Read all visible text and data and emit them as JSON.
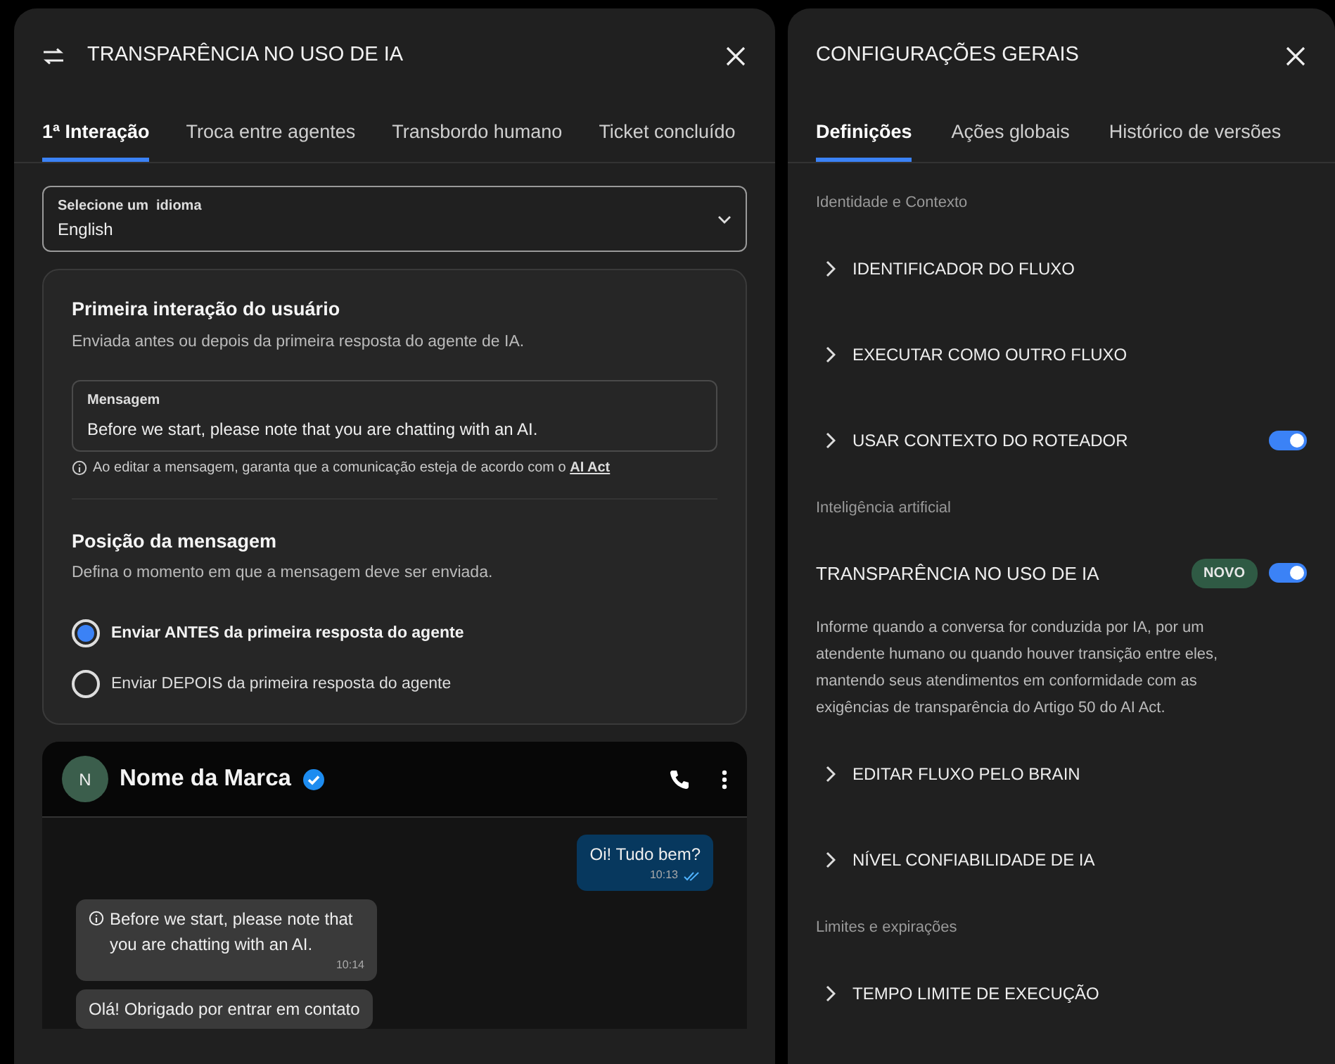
{
  "left_panel": {
    "title": "TRANSPARÊNCIA NO USO DE IA",
    "tabs": [
      {
        "label": "1ª Interação",
        "selected": true
      },
      {
        "label": "Troca entre agentes",
        "selected": false
      },
      {
        "label": "Transbordo humano",
        "selected": false
      },
      {
        "label": "Ticket concluído",
        "selected": false
      }
    ],
    "language_select": {
      "label": "Selecione um  idioma",
      "value": "English"
    },
    "first_interaction": {
      "title": "Primeira interação do usuário",
      "subtitle": "Enviada antes ou depois da primeira resposta do agente de IA.",
      "message_field": {
        "label": "Mensagem",
        "value": "Before we start, please note that you are chatting with an AI."
      },
      "hint": "Ao editar a mensagem, garanta que a comunicação esteja de acordo com o",
      "hint_link": "AI Act"
    },
    "position": {
      "title": "Posição da mensagem",
      "subtitle": "Defina o momento em que a mensagem deve ser enviada.",
      "options": [
        {
          "label": "Enviar ANTES da primeira resposta do agente",
          "selected": true
        },
        {
          "label": "Enviar DEPOIS da primeira resposta do agente",
          "selected": false
        }
      ]
    },
    "chat_preview": {
      "avatar_letter": "N",
      "name": "Nome da Marca",
      "messages": [
        {
          "kind": "outgoing",
          "text": "Oi! Tudo bem?",
          "time": "10:13"
        },
        {
          "kind": "notice",
          "text": "Before we start, please note that you are chatting with an AI.",
          "time": "10:14"
        },
        {
          "kind": "incoming",
          "text": "Olá! Obrigado por entrar em contato"
        }
      ]
    }
  },
  "right_panel": {
    "title": "CONFIGURAÇÕES GERAIS",
    "tabs": [
      {
        "label": "Definições",
        "selected": true
      },
      {
        "label": "Ações globais",
        "selected": false
      },
      {
        "label": "Histórico de versões",
        "selected": false
      }
    ],
    "items": [
      {
        "kind": "section",
        "text": "Identidade e Contexto"
      },
      {
        "kind": "expander",
        "label": "IDENTIFICADOR DO FLUXO"
      },
      {
        "kind": "expander",
        "label": "EXECUTAR COMO OUTRO FLUXO"
      },
      {
        "kind": "expander",
        "label": "USAR CONTEXTO DO ROTEADOR",
        "on": true
      },
      {
        "kind": "section",
        "text": "Inteligência artificial"
      },
      {
        "kind": "feature",
        "label": "TRANSPARÊNCIA NO USO DE IA",
        "badge": "NOVO",
        "on": true,
        "description": "Informe quando a conversa for conduzida por IA, por um atendente humano ou quando houver transição entre eles, mantendo seus atendimentos em conformidade com as exigências de transparência do Artigo 50 do AI Act."
      },
      {
        "kind": "expander",
        "label": "EDITAR FLUXO PELO BRAIN"
      },
      {
        "kind": "expander",
        "label": "NÍVEL CONFIABILIDADE DE IA"
      },
      {
        "kind": "section",
        "text": "Limites e expirações"
      },
      {
        "kind": "expander",
        "label": "TEMPO LIMITE DE EXECUÇÃO"
      }
    ]
  }
}
